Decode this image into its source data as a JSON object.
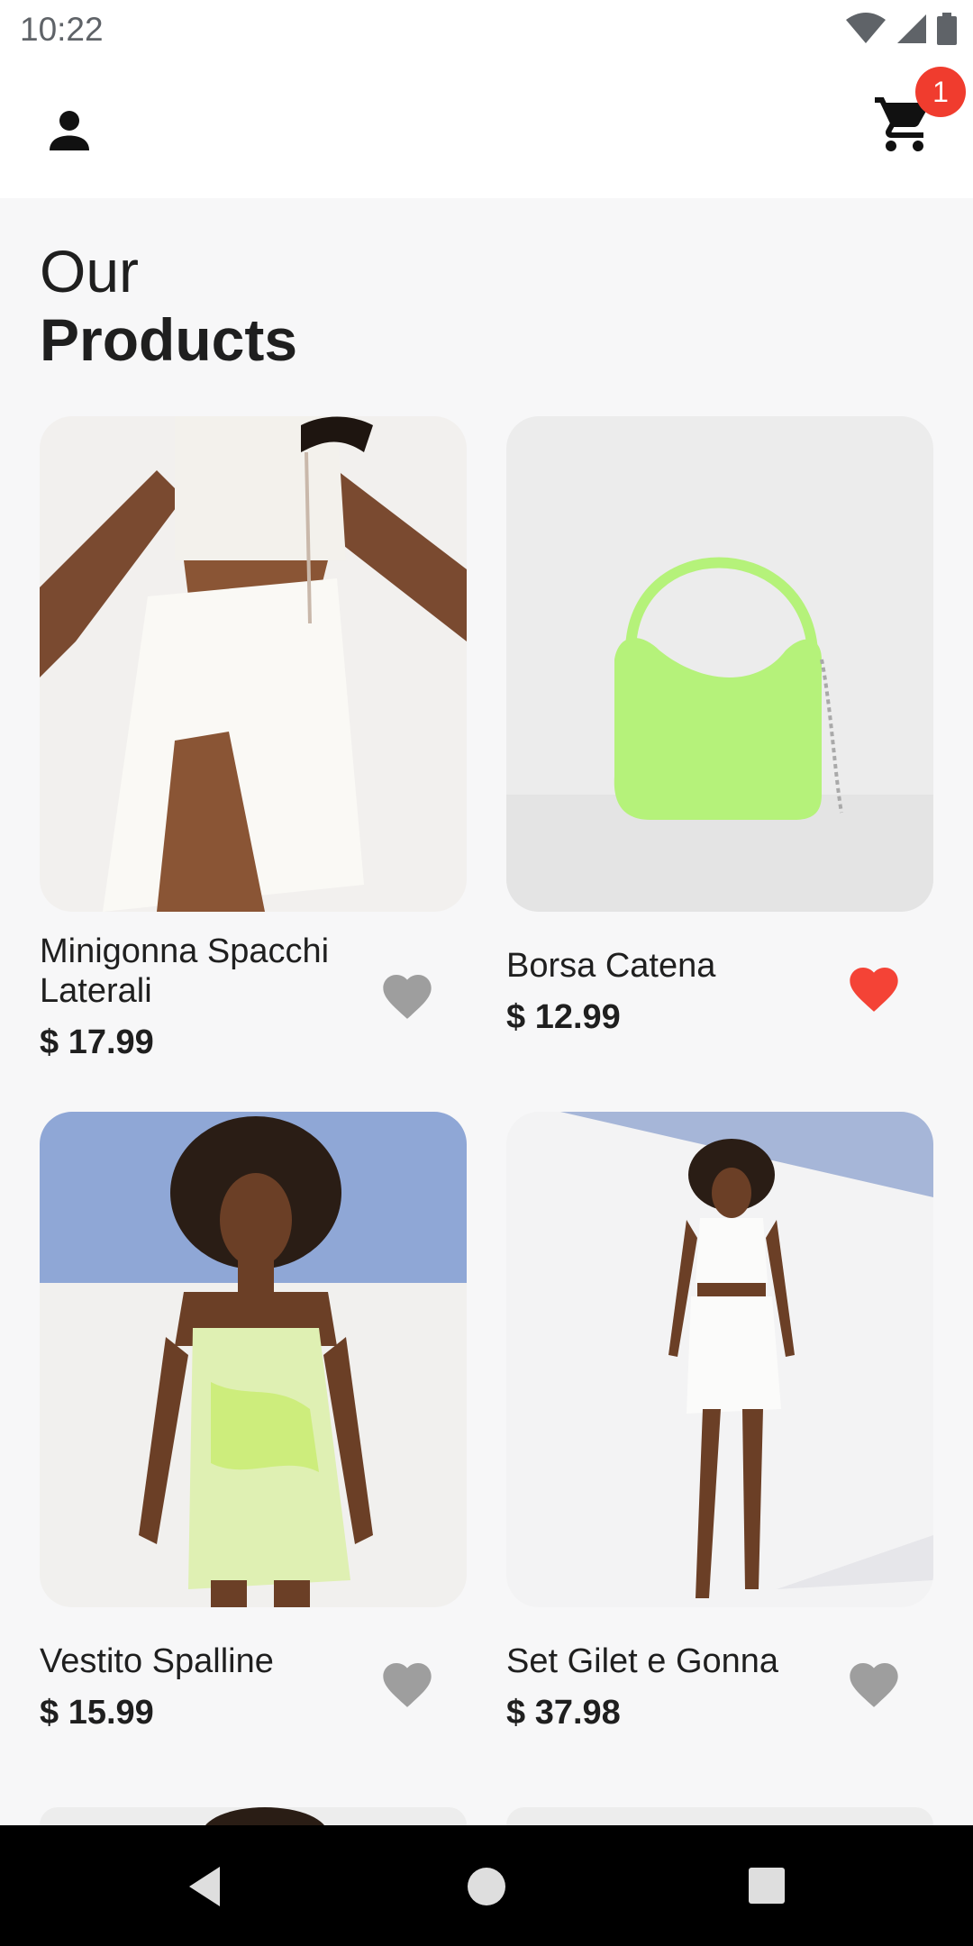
{
  "status_bar": {
    "time": "10:22",
    "icons": [
      "wifi-icon",
      "signal-icon",
      "battery-icon"
    ]
  },
  "app_bar": {
    "profile_icon": "person-icon",
    "cart_icon": "shopping-cart-icon",
    "cart_count": "1",
    "badge_color": "#f03c2e"
  },
  "heading": {
    "line1": "Our",
    "line2": "Products"
  },
  "products": [
    {
      "name": "Minigonna Spacchi Laterali",
      "price": "$ 17.99",
      "favorite": false
    },
    {
      "name": "Borsa Catena",
      "price": "$ 12.99",
      "favorite": true
    },
    {
      "name": "Vestito Spalline",
      "price": "$ 15.99",
      "favorite": false
    },
    {
      "name": "Set Gilet e Gonna",
      "price": "$ 37.98",
      "favorite": false
    }
  ],
  "colors": {
    "favorite_active": "#f44336",
    "favorite_inactive": "#9e9e9e",
    "bag_green": "#b5f27a"
  },
  "nav_bar": {
    "icons": [
      "back-icon",
      "home-icon",
      "recents-icon"
    ]
  }
}
